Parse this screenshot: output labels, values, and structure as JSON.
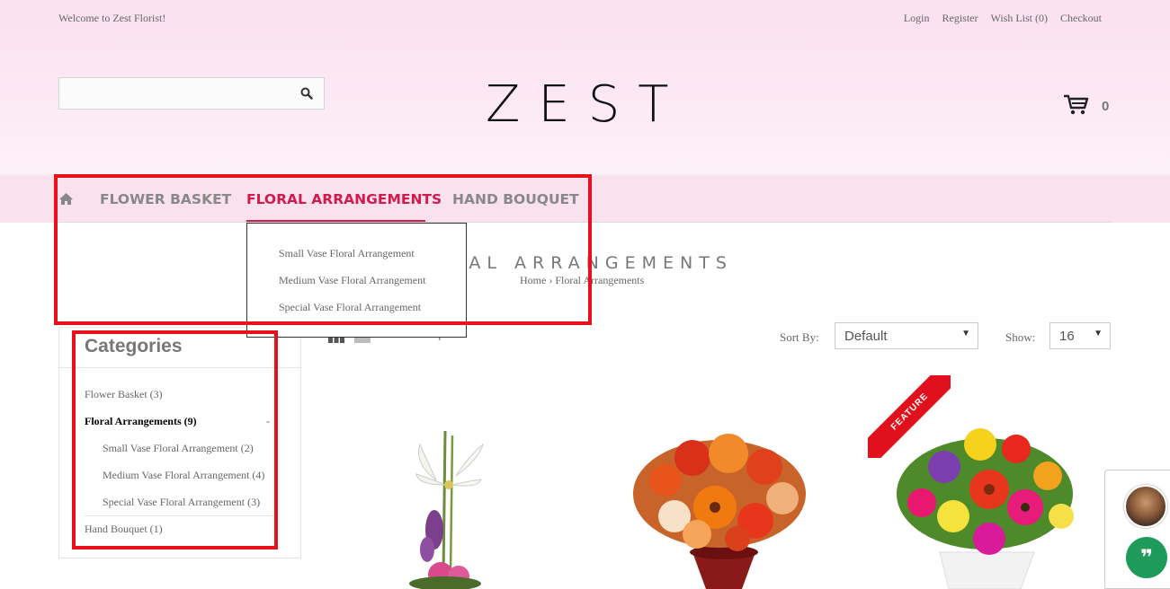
{
  "topbar": {
    "welcome": "Welcome to Zest Florist!",
    "links": [
      "Login",
      "Register",
      "Wish List (0)",
      "Checkout"
    ]
  },
  "search": {
    "placeholder": "",
    "icon": "search-icon"
  },
  "logo": "ZEST",
  "cart": {
    "icon": "cart-icon",
    "count": "0"
  },
  "nav": {
    "home_icon": "home-icon",
    "items": [
      "FLOWER BASKET",
      "FLORAL ARRANGEMENTS",
      "HAND BOUQUET"
    ],
    "active": "FLORAL ARRANGEMENTS",
    "accent_color": "#d11b4d"
  },
  "dropdown": {
    "items": [
      "Small Vase Floral Arrangement",
      "Medium Vase Floral Arrangement",
      "Special Vase Floral Arrangement"
    ]
  },
  "page": {
    "title_visible": "RAL ARRANGEMENTS",
    "breadcrumb": [
      "Home",
      "Floral Arrangements"
    ],
    "breadcrumb_separator": "›"
  },
  "categories": {
    "title": "Categories",
    "items": [
      {
        "label": "Flower Basket (3)"
      },
      {
        "label": "Floral Arrangements (9)",
        "toggle": "-"
      },
      {
        "label": "Small Vase Floral Arrangement (2)"
      },
      {
        "label": "Medium Vase Floral Arrangement (4)"
      },
      {
        "label": "Special Vase Floral Arrangement (3)"
      },
      {
        "label": "Hand Bouquet (1)"
      }
    ]
  },
  "toolbar": {
    "view_icons": [
      "grid-view-icon",
      "list-view-icon"
    ],
    "compare_visible": "Compare",
    "sort_label": "Sort By:",
    "sort_value": "Default",
    "show_label": "Show:",
    "show_value": "16"
  },
  "products": {
    "badge": "FEATURE",
    "badge_color": "#e0101c"
  },
  "chat": {
    "button_icon": "quote-icon",
    "button_glyph": "❞",
    "button_color": "#1e9a5a"
  }
}
